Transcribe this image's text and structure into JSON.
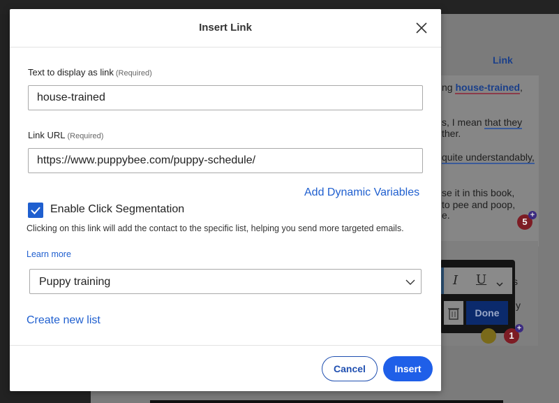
{
  "background": {
    "link_tab": "Link",
    "doc_lines": [
      {
        "pre": "ng ",
        "link": "house-trained",
        "post": ","
      },
      {
        "pre": "s, I mean ",
        "link": "that they"
      },
      {
        "pre": "ther."
      },
      {
        "link": "quite understandably,"
      },
      {
        "pre": "se it in this book,"
      },
      {
        "pre": "to pee and poop,"
      },
      {
        "pre": "e."
      }
    ],
    "side_text": [
      "s",
      "y"
    ],
    "badge_count": "5",
    "badge_count_2": "1",
    "toolbar": {
      "italic": "I",
      "underline": "U",
      "done_label": "Done"
    },
    "colors": {
      "done": "#0b2a6c",
      "badge": "#7d1c24"
    }
  },
  "modal": {
    "title": "Insert Link",
    "text_label": "Text to display as link",
    "text_required": "(Required)",
    "text_value": "house-trained",
    "url_label": "Link URL",
    "url_required": "(Required)",
    "url_value": "https://www.puppybee.com/puppy-schedule/",
    "dynamic_variables": "Add Dynamic Variables",
    "click_segmentation_label": "Enable Click Segmentation",
    "click_segmentation_checked": true,
    "help_text": "Clicking on this link will add the contact to the specific list, helping you send more targeted emails.",
    "learn_more": "Learn more",
    "list_selected": "Puppy training",
    "create_list": "Create new list",
    "cancel": "Cancel",
    "insert": "Insert",
    "colors": {
      "primary": "#1f5fe8",
      "link": "#1f5fcf"
    }
  }
}
